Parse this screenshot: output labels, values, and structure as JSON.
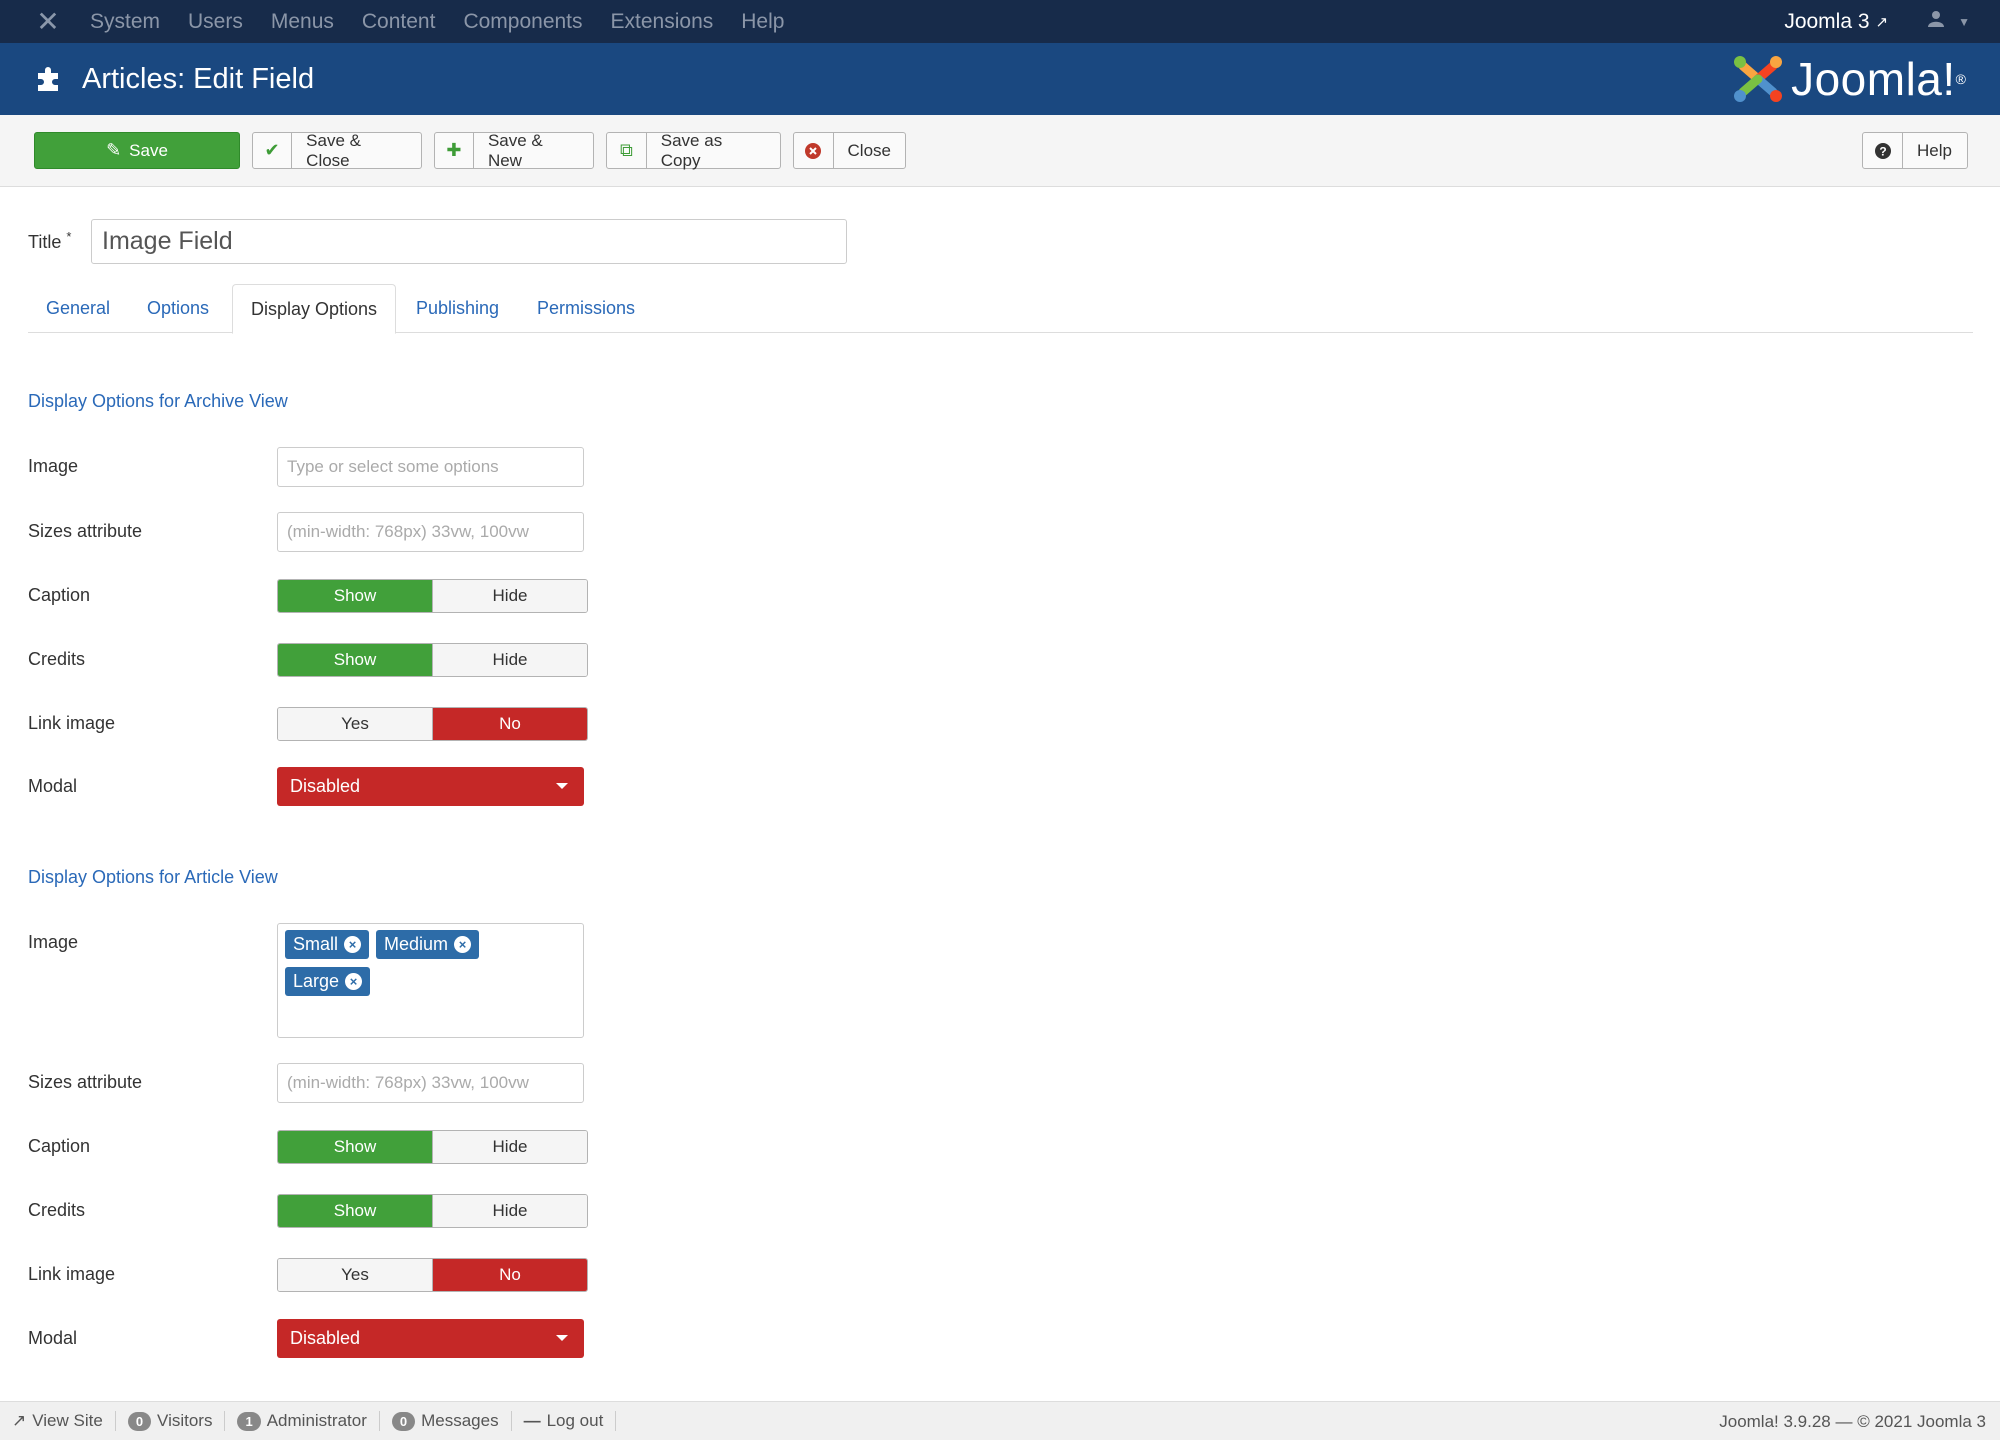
{
  "topnav": {
    "menu": [
      "System",
      "Users",
      "Menus",
      "Content",
      "Components",
      "Extensions",
      "Help"
    ],
    "site_name": "Joomla 3"
  },
  "header": {
    "title": "Articles: Edit Field",
    "brand": "Joomla!"
  },
  "toolbar": {
    "save": "Save",
    "save_close": "Save & Close",
    "save_new": "Save & New",
    "save_copy": "Save as Copy",
    "close": "Close",
    "help": "Help"
  },
  "form": {
    "title_label": "Title",
    "title_required": "*",
    "title_value": "Image Field"
  },
  "tabs": [
    "General",
    "Options",
    "Display Options",
    "Publishing",
    "Permissions"
  ],
  "active_tab": "Display Options",
  "archive": {
    "heading": "Display Options for Archive View",
    "image_label": "Image",
    "image_placeholder": "Type or select some options",
    "sizes_label": "Sizes attribute",
    "sizes_placeholder": "(min-width: 768px) 33vw, 100vw",
    "caption_label": "Caption",
    "credits_label": "Credits",
    "link_label": "Link image",
    "modal_label": "Modal",
    "show": "Show",
    "hide": "Hide",
    "yes": "Yes",
    "no": "No",
    "caption_value": "Show",
    "credits_value": "Show",
    "link_value": "No",
    "modal_value": "Disabled"
  },
  "article": {
    "heading": "Display Options for Article View",
    "image_label": "Image",
    "image_tags": [
      "Small",
      "Medium",
      "Large"
    ],
    "sizes_label": "Sizes attribute",
    "sizes_placeholder": "(min-width: 768px) 33vw, 100vw",
    "caption_label": "Caption",
    "credits_label": "Credits",
    "link_label": "Link image",
    "modal_label": "Modal",
    "show": "Show",
    "hide": "Hide",
    "yes": "Yes",
    "no": "No",
    "caption_value": "Show",
    "credits_value": "Show",
    "link_value": "No",
    "modal_value": "Disabled"
  },
  "footer": {
    "view_site": "View Site",
    "visitors_count": "0",
    "visitors": "Visitors",
    "admin_count": "1",
    "admin": "Administrator",
    "messages_count": "0",
    "messages": "Messages",
    "logout": "Log out",
    "version": "Joomla! 3.9.28",
    "copyright": "© 2021 Joomla 3"
  },
  "colors": {
    "topnav_bg": "#172b4a",
    "header_bg": "#1a4880",
    "success": "#41a03a",
    "danger": "#c52827",
    "link": "#2a69b8"
  }
}
